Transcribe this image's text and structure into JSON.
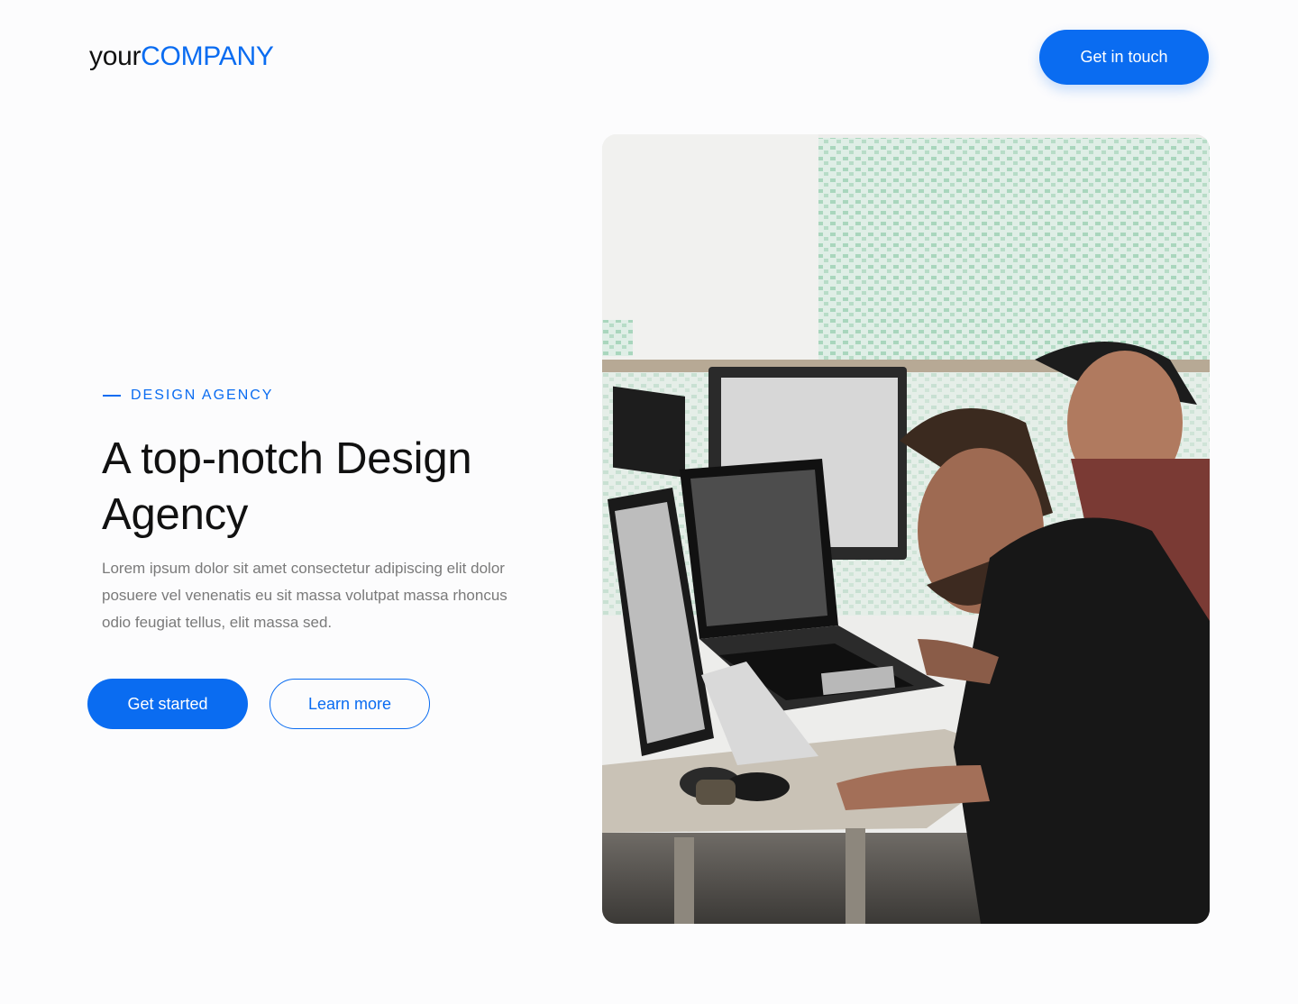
{
  "header": {
    "logo_part1": "your",
    "logo_part2": "COMPANY",
    "cta_label": "Get in touch"
  },
  "hero": {
    "eyebrow": "DESIGN AGENCY",
    "title_line1": "A top-notch Design",
    "title_line2": "Agency",
    "description": "Lorem ipsum dolor sit amet consectetur adipiscing elit dolor posuere vel venenatis eu sit massa volutpat massa rhoncus odio feugiat tellus, elit massa sed.",
    "primary_button": "Get started",
    "secondary_button": "Learn more"
  },
  "colors": {
    "accent": "#0a6cf1",
    "text": "#111111",
    "muted_text": "#7a7a7a",
    "background": "#fcfcfd"
  }
}
